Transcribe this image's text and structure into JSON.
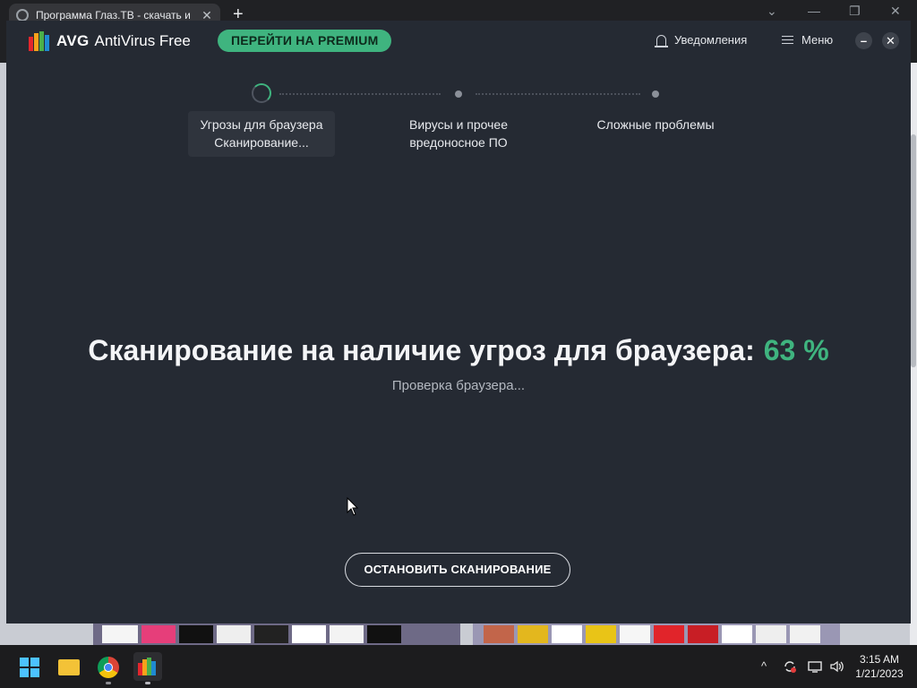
{
  "browser": {
    "tab_title": "Программа Глаз.ТВ - скачать и",
    "tab_close": "✕",
    "new_tab": "+",
    "minimize": "—",
    "maximize": "❐",
    "close": "✕",
    "dropdown": "⌄"
  },
  "avg": {
    "logo_brand": "AVG",
    "logo_product": "AntiVirus Free",
    "premium_button": "ПЕРЕЙТИ НА PREMIUM",
    "notifications_label": "Уведомления",
    "menu_label": "Меню",
    "minimize": "–",
    "close": "✕",
    "steps": [
      {
        "line1": "Угрозы для браузера",
        "line2": "Сканирование...",
        "state": "active"
      },
      {
        "line1": "Вирусы и прочее",
        "line2": "вредоносное ПО",
        "state": "pending"
      },
      {
        "line1": "Сложные проблемы",
        "line2": "",
        "state": "pending"
      }
    ],
    "headline": "Сканирование на наличие угроз для браузера:",
    "progress_text": "63 %",
    "progress_value": 63,
    "status_text": "Проверка браузера...",
    "stop_button": "ОСТАНОВИТЬ СКАНИРОВАНИЕ",
    "accent_color": "#3fb47f",
    "background_color": "#252a33"
  },
  "taskbar": {
    "apps": [
      "start-icon",
      "file-explorer-icon",
      "chrome-icon",
      "avg-icon"
    ],
    "tray_chevron": "^",
    "time": "3:15 AM",
    "date": "1/21/2023"
  }
}
